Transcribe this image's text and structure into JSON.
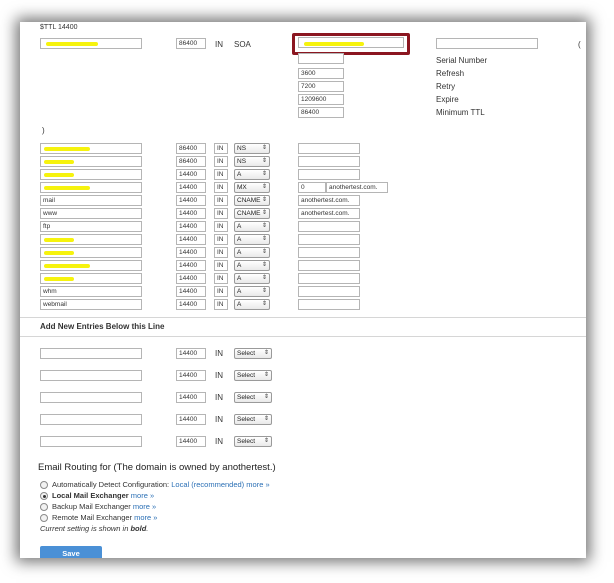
{
  "header": {
    "ttl_label": "$TTL 14400"
  },
  "soa": {
    "ttl": "86400",
    "class": "IN",
    "type": "SOA",
    "fields": [
      {
        "value": "3600",
        "label": "Refresh"
      },
      {
        "value": "7200",
        "label": "Retry"
      },
      {
        "value": "1209600",
        "label": "Expire"
      },
      {
        "value": "86400",
        "label": "Minimum TTL"
      }
    ],
    "serial_label": "Serial Number",
    "paren_open": "(",
    "paren_close": ")"
  },
  "records": [
    {
      "name": "",
      "ttl": "86400",
      "class": "IN",
      "type": "NS",
      "prio": "",
      "target": ""
    },
    {
      "name": "",
      "ttl": "86400",
      "class": "IN",
      "type": "NS",
      "prio": "",
      "target": ""
    },
    {
      "name": "",
      "ttl": "14400",
      "class": "IN",
      "type": "A",
      "prio": "",
      "target": ""
    },
    {
      "name": "",
      "ttl": "14400",
      "class": "IN",
      "type": "MX",
      "prio": "0",
      "target": "anothertest.com."
    },
    {
      "name": "mail",
      "ttl": "14400",
      "class": "IN",
      "type": "CNAME",
      "prio": "",
      "target": "anothertest.com."
    },
    {
      "name": "www",
      "ttl": "14400",
      "class": "IN",
      "type": "CNAME",
      "prio": "",
      "target": "anothertest.com."
    },
    {
      "name": "ftp",
      "ttl": "14400",
      "class": "IN",
      "type": "A",
      "prio": "",
      "target": ""
    },
    {
      "name": "",
      "ttl": "14400",
      "class": "IN",
      "type": "A",
      "prio": "",
      "target": ""
    },
    {
      "name": "",
      "ttl": "14400",
      "class": "IN",
      "type": "A",
      "prio": "",
      "target": ""
    },
    {
      "name": "",
      "ttl": "14400",
      "class": "IN",
      "type": "A",
      "prio": "",
      "target": ""
    },
    {
      "name": "",
      "ttl": "14400",
      "class": "IN",
      "type": "A",
      "prio": "",
      "target": ""
    },
    {
      "name": "whm",
      "ttl": "14400",
      "class": "IN",
      "type": "A",
      "prio": "",
      "target": ""
    },
    {
      "name": "webmail",
      "ttl": "14400",
      "class": "IN",
      "type": "A",
      "prio": "",
      "target": ""
    }
  ],
  "new_entries": {
    "title": "Add New Entries Below this Line",
    "rows": [
      {
        "ttl": "14400",
        "class": "IN",
        "type": "Select"
      },
      {
        "ttl": "14400",
        "class": "IN",
        "type": "Select"
      },
      {
        "ttl": "14400",
        "class": "IN",
        "type": "Select"
      },
      {
        "ttl": "14400",
        "class": "IN",
        "type": "Select"
      },
      {
        "ttl": "14400",
        "class": "IN",
        "type": "Select"
      }
    ]
  },
  "routing": {
    "title": "Email Routing for (The domain is owned by anothertest.)",
    "options": [
      {
        "label": "Automatically Detect Configuration:",
        "extra": "Local (recommended)",
        "more": "more »",
        "selected": false
      },
      {
        "label": "Local Mail Exchanger",
        "extra": "",
        "more": "more »",
        "selected": true
      },
      {
        "label": "Backup Mail Exchanger",
        "extra": "",
        "more": "more »",
        "selected": false
      },
      {
        "label": "Remote Mail Exchanger",
        "extra": "",
        "more": "more »",
        "selected": false
      }
    ],
    "note_prefix": "Current setting is shown in",
    "note_bold": "bold",
    "note_suffix": "."
  },
  "buttons": {
    "save": "Save"
  },
  "colors": {
    "highlight": "#8b1620",
    "redaction": "#f5f200",
    "save": "#4a90d6",
    "link": "#2a6fb5"
  }
}
